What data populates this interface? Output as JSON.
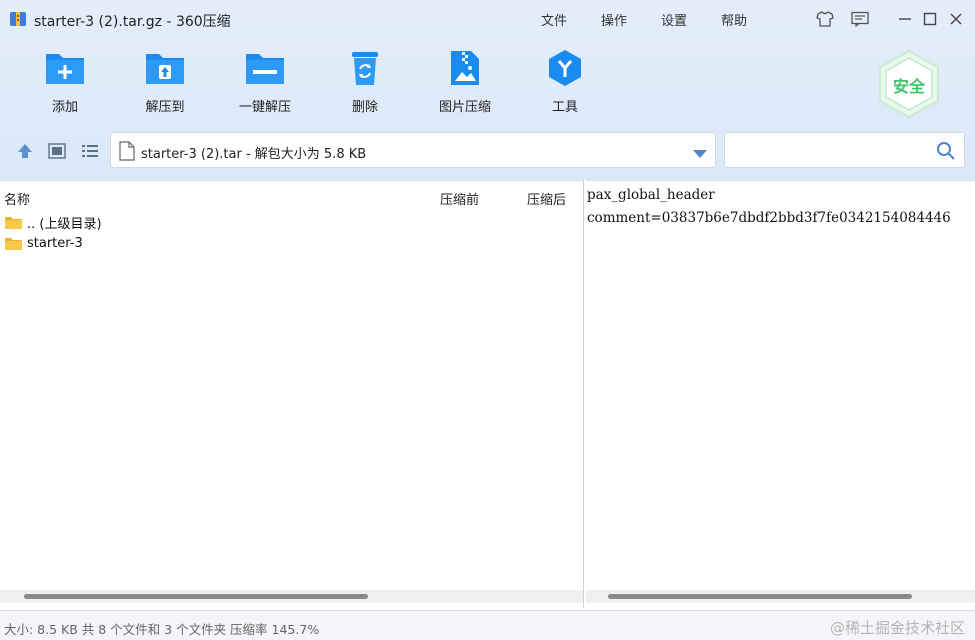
{
  "window": {
    "title": "starter-3 (2).tar.gz - 360压缩"
  },
  "menu": [
    "文件",
    "操作",
    "设置",
    "帮助"
  ],
  "toolbar": {
    "items": [
      {
        "label": "添加",
        "icon": "add-folder-icon"
      },
      {
        "label": "解压到",
        "icon": "extract-to-icon"
      },
      {
        "label": "一键解压",
        "icon": "one-click-extract-icon"
      },
      {
        "label": "删除",
        "icon": "trash-icon"
      },
      {
        "label": "图片压缩",
        "icon": "image-compress-icon"
      },
      {
        "label": "工具",
        "icon": "tools-icon"
      }
    ],
    "safe_badge": "安全"
  },
  "address": {
    "path": "starter-3 (2).tar - 解包大小为 5.8 KB"
  },
  "search": {
    "placeholder": ""
  },
  "file_list": {
    "columns": [
      "名称",
      "压缩前",
      "压缩后"
    ],
    "rows": [
      {
        "name": ".. (上级目录)",
        "type": "folder"
      },
      {
        "name": "starter-3",
        "type": "folder"
      }
    ]
  },
  "preview": {
    "lines": [
      "pax_global_header",
      "comment=03837b6e7dbdf2bbd3f7fe0342154084446"
    ]
  },
  "status": {
    "text": "大小: 8.5 KB 共 8 个文件和 3 个文件夹 压缩率 145.7%",
    "watermark": "@稀土掘金技术社区"
  },
  "colors": {
    "accent": "#1a8cf0",
    "safe_green": "#3cc46a",
    "folder": "#f7c94a"
  }
}
